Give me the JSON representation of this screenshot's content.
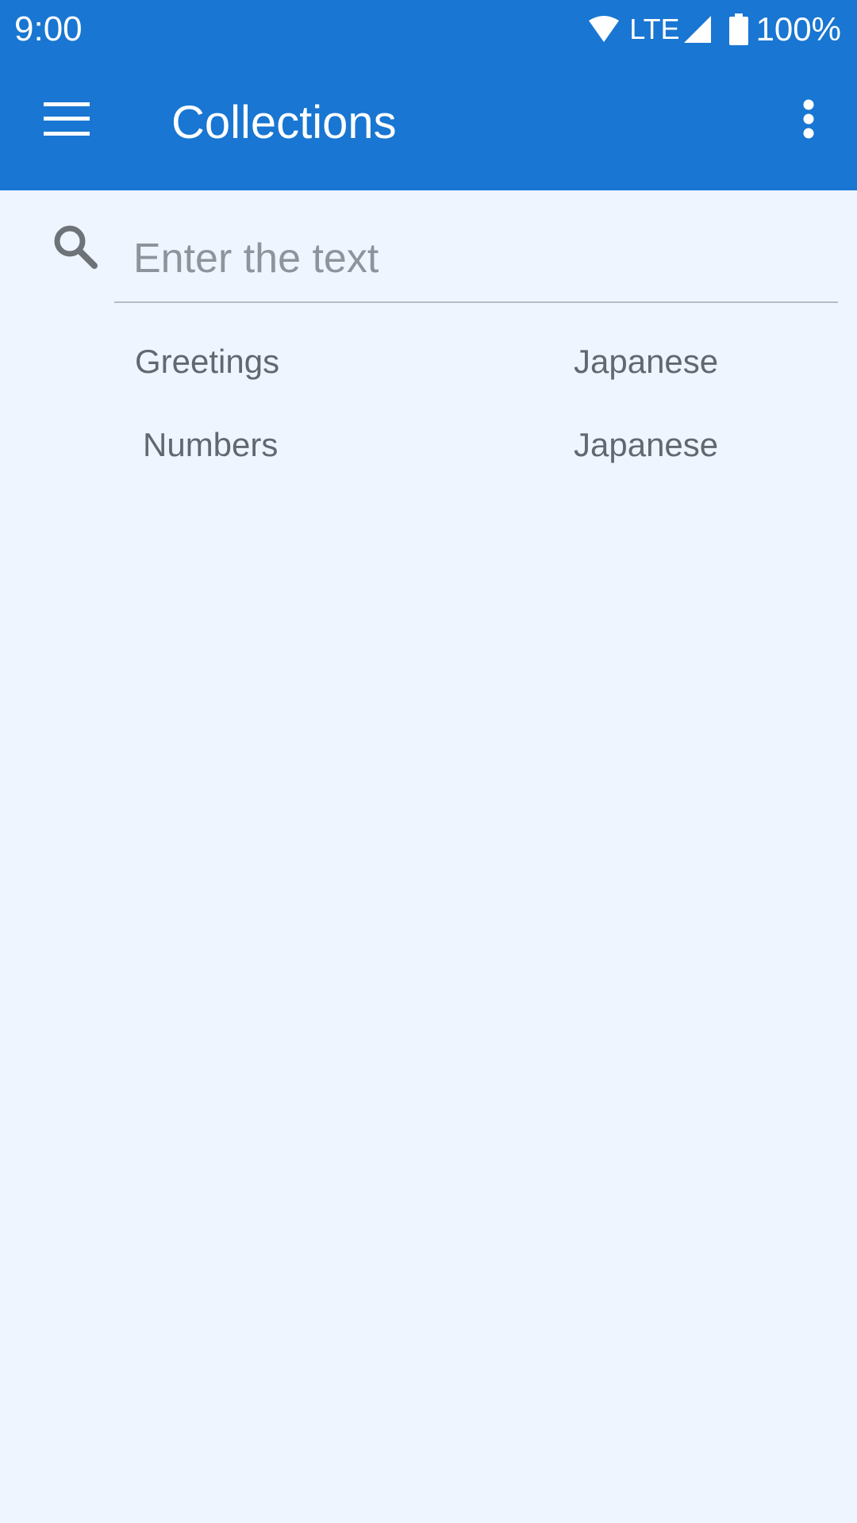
{
  "status_bar": {
    "time": "9:00",
    "network": "LTE",
    "battery": "100%",
    "icons": [
      "wifi-icon",
      "cell-signal-icon",
      "battery-icon"
    ]
  },
  "toolbar": {
    "title": "Collections",
    "menu_icon": "hamburger-menu-icon",
    "more_icon": "more-vert-icon"
  },
  "search": {
    "placeholder": "Enter the text",
    "value": "",
    "icon": "search-icon"
  },
  "collections": [
    {
      "name": "Greetings",
      "language": "Japanese"
    },
    {
      "name": "Numbers",
      "language": "Japanese"
    }
  ],
  "colors": {
    "primary": "#1976d2",
    "background": "#eef5ff",
    "text_secondary": "#626870",
    "placeholder": "#8e949b",
    "divider": "#b5bcc6"
  }
}
